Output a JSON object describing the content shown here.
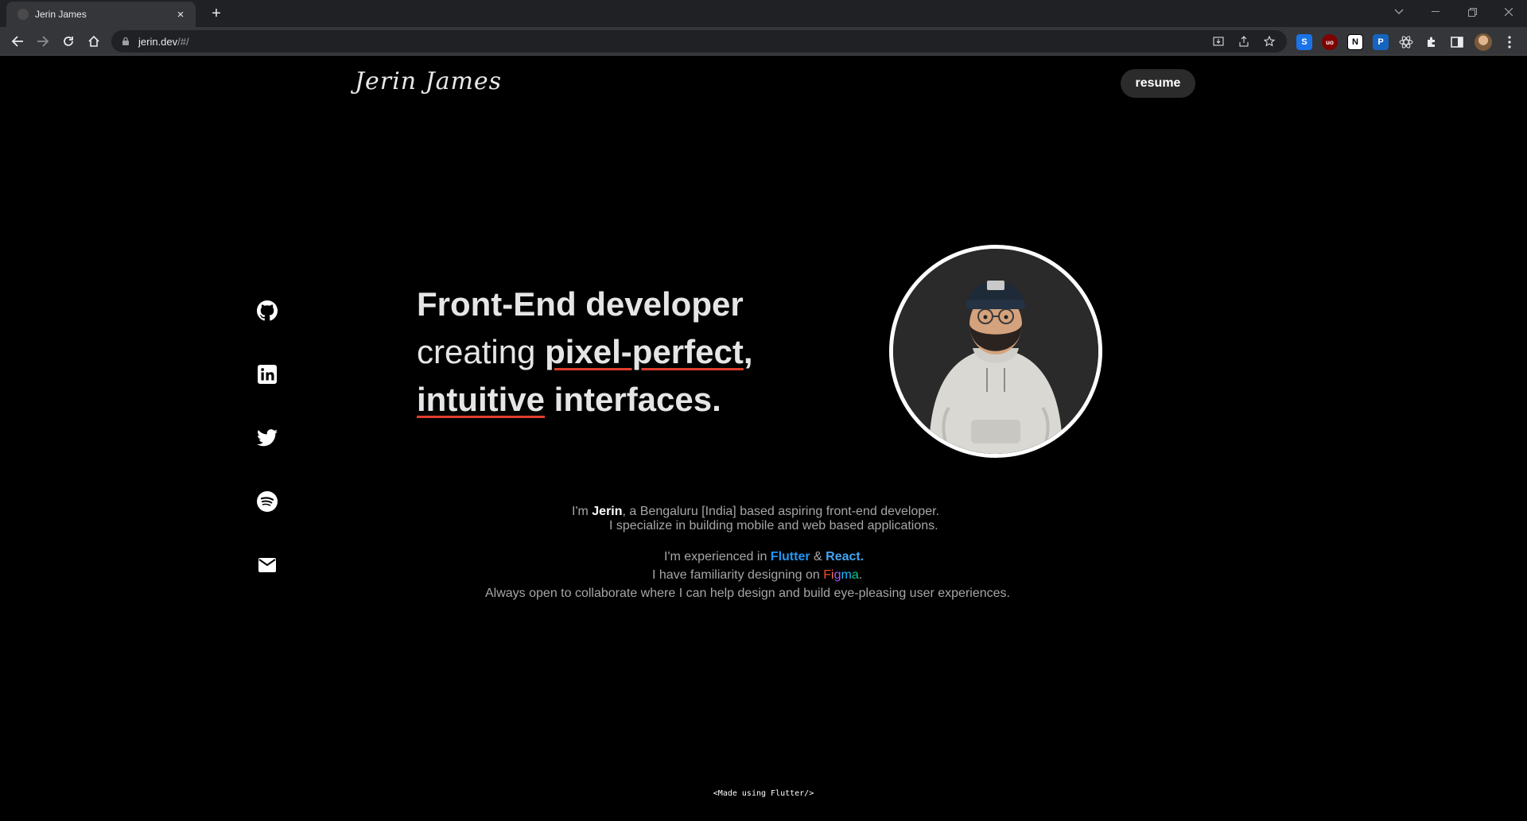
{
  "browser": {
    "tab_title": "Jerin James",
    "url_host": "jerin.dev",
    "url_path": "/#/",
    "new_tab_label": "+",
    "tab_close_label": "×"
  },
  "site": {
    "logo_text": "Jerin James",
    "resume_label": "resume",
    "social": [
      "github-icon",
      "linkedin-icon",
      "twitter-icon",
      "spotify-icon",
      "mail-icon"
    ]
  },
  "hero": {
    "line1": "Front-End developer",
    "line2_plain": "creating ",
    "line2_emph": "pixel-perfect",
    "line2_comma": ",",
    "line3_emph": "intuitive",
    "line3_plain": " interfaces."
  },
  "about": {
    "p1_prefix": "I'm ",
    "p1_name": "Jerin",
    "p1_suffix": ", a Bengaluru [India] based aspiring front-end developer.",
    "p2": "I specialize in building mobile and web based applications.",
    "p3_prefix": "I'm experienced in ",
    "p3_flutter": "Flutter",
    "p3_amp": " & ",
    "p3_react": "React.",
    "p4_prefix": "I have familiarity designing on ",
    "p4_figma": "Figma",
    "p4_suffix": ".",
    "p5": "Always open to collaborate where I can help design and build eye-pleasing user experiences."
  },
  "footer": {
    "note": "<Made using Flutter/>"
  },
  "colors": {
    "accent_underline": "#e03e2d",
    "flutter": "#2196f3",
    "react": "#42a5f5"
  }
}
